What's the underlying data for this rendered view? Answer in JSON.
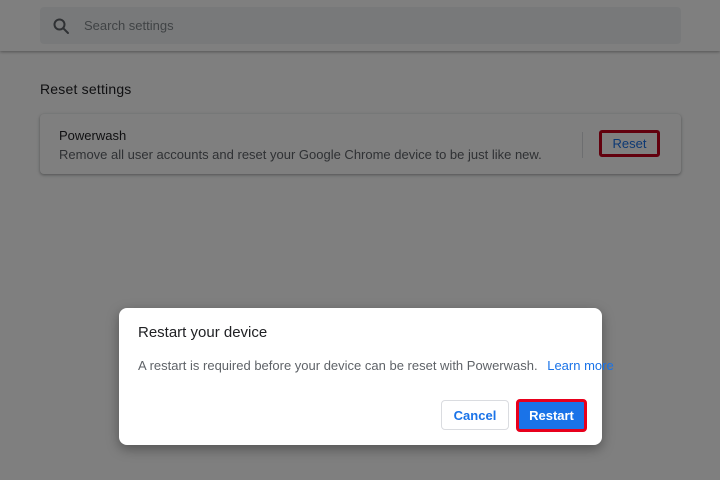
{
  "search": {
    "placeholder": "Search settings",
    "icon": "search-icon"
  },
  "section": {
    "title": "Reset settings"
  },
  "powerwash": {
    "title": "Powerwash",
    "description": "Remove all user accounts and reset your Google Chrome device to be just like new.",
    "reset_label": "Reset"
  },
  "dialog": {
    "title": "Restart your device",
    "body": "A restart is required before your device can be reset with Powerwash.",
    "learn_more": "Learn more",
    "cancel_label": "Cancel",
    "restart_label": "Restart"
  },
  "colors": {
    "accent": "#1a73e8",
    "highlight_border": "#d50000",
    "scrim": "rgba(0,0,0,0.5)"
  }
}
